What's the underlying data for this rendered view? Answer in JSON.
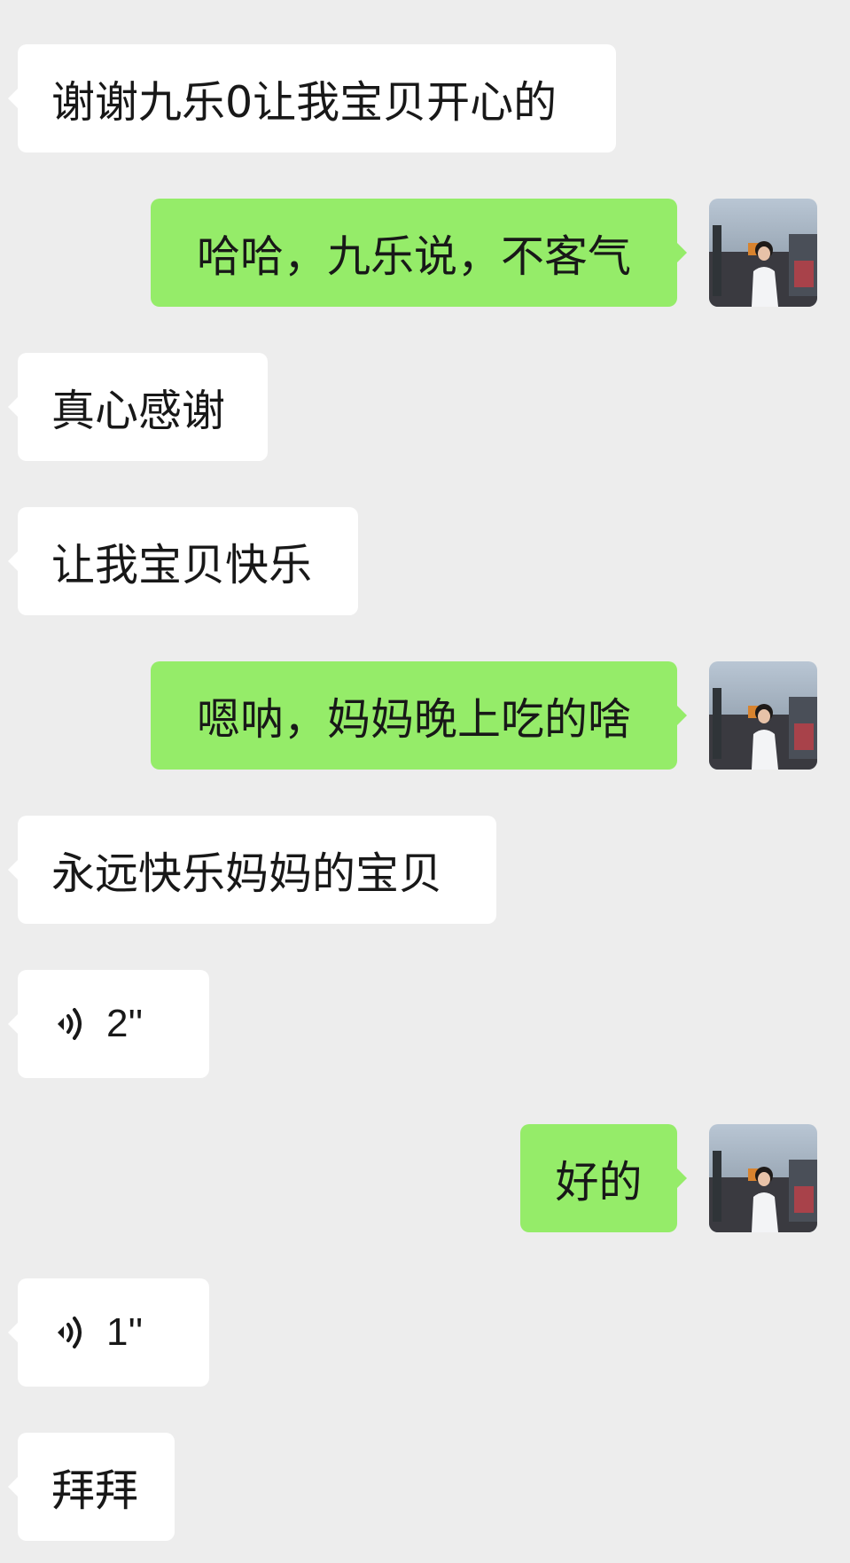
{
  "colors": {
    "background": "#ededed",
    "incoming_bubble": "#ffffff",
    "outgoing_bubble": "#95ec69",
    "text": "#181818"
  },
  "messages": [
    {
      "side": "incoming",
      "type": "text",
      "text": "谢谢九乐0让我宝贝开心的"
    },
    {
      "side": "outgoing",
      "type": "text",
      "text": "哈哈，九乐说，不客气"
    },
    {
      "side": "incoming",
      "type": "text",
      "text": "真心感谢"
    },
    {
      "side": "incoming",
      "type": "text",
      "text": "让我宝贝快乐"
    },
    {
      "side": "outgoing",
      "type": "text",
      "text": "嗯呐，妈妈晚上吃的啥"
    },
    {
      "side": "incoming",
      "type": "text",
      "text": "永远快乐妈妈的宝贝"
    },
    {
      "side": "incoming",
      "type": "voice",
      "icon": "voice-wave-icon",
      "duration": "2''"
    },
    {
      "side": "outgoing",
      "type": "text",
      "text": "好的"
    },
    {
      "side": "incoming",
      "type": "voice",
      "icon": "voice-wave-icon",
      "duration": "1''"
    },
    {
      "side": "incoming",
      "type": "text",
      "text": "拜拜"
    }
  ]
}
